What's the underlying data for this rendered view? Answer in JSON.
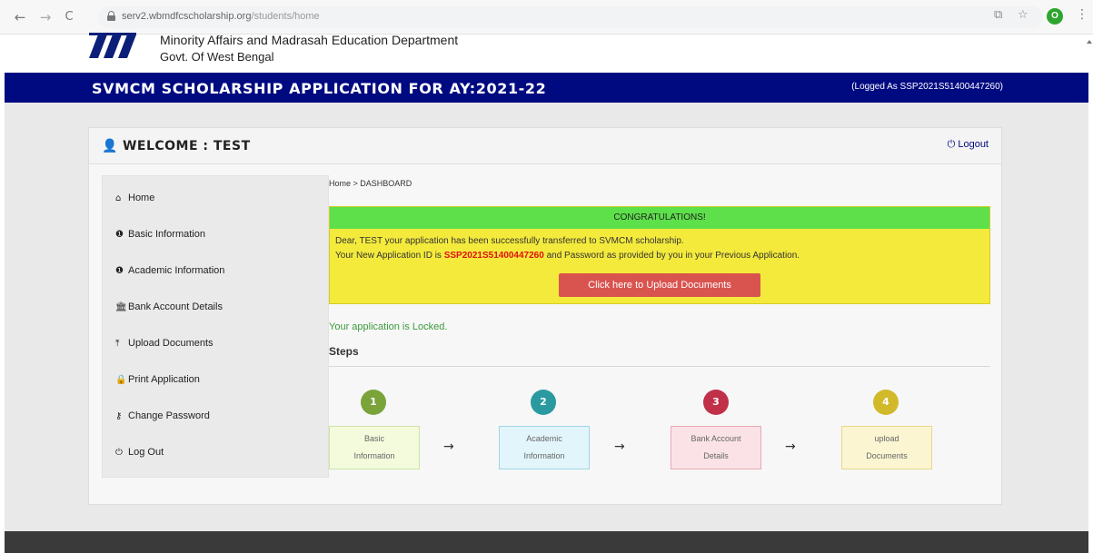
{
  "browser": {
    "back": "←",
    "forward": "→",
    "reload": "C",
    "url_host": "serv2.wbmdfcscholarship.org",
    "url_path": "/students/home",
    "profile_initial": "O"
  },
  "header": {
    "department": "Minority Affairs and Madrasah Education Department",
    "government": "Govt. Of West Bengal",
    "banner_title": "SVMCM SCHOLARSHIP APPLICATION FOR AY:2021-22",
    "logged_as": "(Logged As SSP2021S51400447260)"
  },
  "panel": {
    "welcome": "WELCOME : TEST",
    "logout": "Logout"
  },
  "sidebar": {
    "items": [
      {
        "icon": "home-icon",
        "label": "Home"
      },
      {
        "icon": "info-icon",
        "label": "Basic Information"
      },
      {
        "icon": "info-icon",
        "label": "Academic Information"
      },
      {
        "icon": "bank-icon",
        "label": "Bank Account Details"
      },
      {
        "icon": "upload-icon",
        "label": "Upload Documents"
      },
      {
        "icon": "lock-icon",
        "label": "Print Application"
      },
      {
        "icon": "key-icon",
        "label": "Change Password"
      },
      {
        "icon": "power-icon",
        "label": "Log Out"
      }
    ]
  },
  "main": {
    "breadcrumb": "Home > DASHBOARD",
    "alert": {
      "heading": "CONGRATULATIONS!",
      "line1": "Dear, TEST your application has been successfully transferred to SVMCM scholarship.",
      "line2_prefix": "Your New Application ID is ",
      "application_id": "SSP2021S51400447260",
      "line2_suffix": " and Password as provided by you in your Previous Application.",
      "button": "Click here to Upload Documents"
    },
    "status": "Your application is Locked.",
    "steps_title": "Steps",
    "steps": [
      {
        "number": "1",
        "line1": "Basic",
        "line2": "Information",
        "color": "#7aa43a",
        "box_bg": "#f3fbdc",
        "box_border": "#cfe3a4"
      },
      {
        "number": "2",
        "line1": "Academic",
        "line2": "Information",
        "color": "#2a9aa0",
        "box_bg": "#e2f5fb",
        "box_border": "#9fd6e6"
      },
      {
        "number": "3",
        "line1": "Bank Account",
        "line2": "Details",
        "color": "#c03048",
        "box_bg": "#fbe2e6",
        "box_border": "#e8aab4"
      },
      {
        "number": "4",
        "line1": "upload",
        "line2": "Documents",
        "color": "#d1b92a",
        "box_bg": "#fbf5d2",
        "box_border": "#e6d98a"
      }
    ]
  },
  "colors": {
    "banner": "#000a80",
    "alert_bg": "#f4ea3c",
    "alert_head": "#5de04a",
    "button": "#d9534f",
    "locked_text": "#3c9a3c"
  }
}
